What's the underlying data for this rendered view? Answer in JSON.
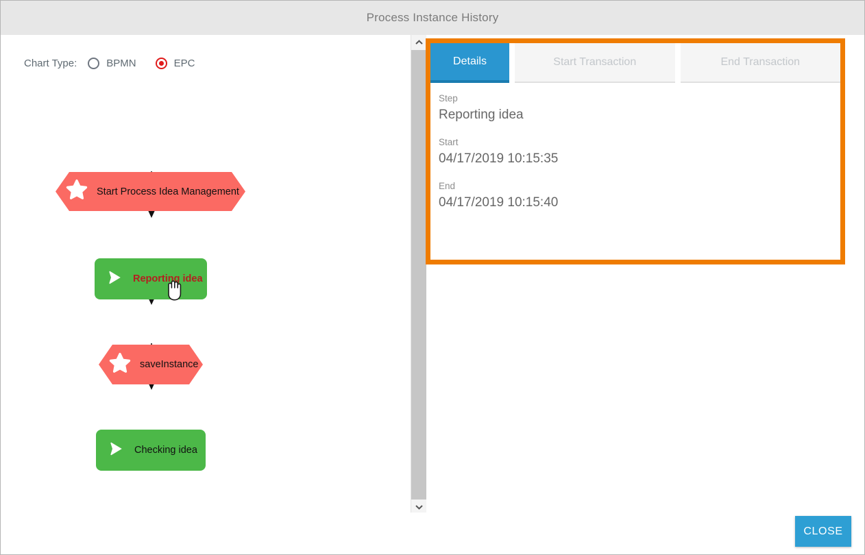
{
  "window": {
    "title": "Process Instance History"
  },
  "chart_type": {
    "label": "Chart Type:",
    "options": [
      {
        "label": "BPMN",
        "selected": false
      },
      {
        "label": "EPC",
        "selected": true
      }
    ]
  },
  "diagram": {
    "notation": "EPC",
    "nodes": [
      {
        "label": "Start Process Idea Management",
        "type": "event",
        "icon": "star-icon",
        "color": "#fb6a63",
        "text_color": "#111111",
        "highlighted": false
      },
      {
        "label": "Reporting idea",
        "type": "function",
        "icon": "play-triangle-icon",
        "color": "#4cb848",
        "text_color": "#b41f1f",
        "highlighted": true
      },
      {
        "label": "saveInstance",
        "type": "event",
        "icon": "star-icon",
        "color": "#fb6a63",
        "text_color": "#111111",
        "highlighted": false
      },
      {
        "label": "Checking idea",
        "type": "function",
        "icon": "play-triangle-icon",
        "color": "#4cb848",
        "text_color": "#111111",
        "highlighted": false
      }
    ],
    "connectors": 3
  },
  "scrollbar": {
    "up_icon": "chevron-up-icon",
    "down_icon": "chevron-down-icon"
  },
  "details_panel": {
    "highlight_color": "#ef7c00",
    "tabs": [
      {
        "label": "Details",
        "state": "active"
      },
      {
        "label": "Start Transaction",
        "state": "disabled"
      },
      {
        "label": "End Transaction",
        "state": "disabled"
      }
    ],
    "fields": [
      {
        "label": "Step",
        "value": "Reporting idea"
      },
      {
        "label": "Start",
        "value": "04/17/2019 10:15:35"
      },
      {
        "label": "End",
        "value": "04/17/2019 10:15:40"
      }
    ]
  },
  "footer": {
    "close_label": "CLOSE"
  }
}
